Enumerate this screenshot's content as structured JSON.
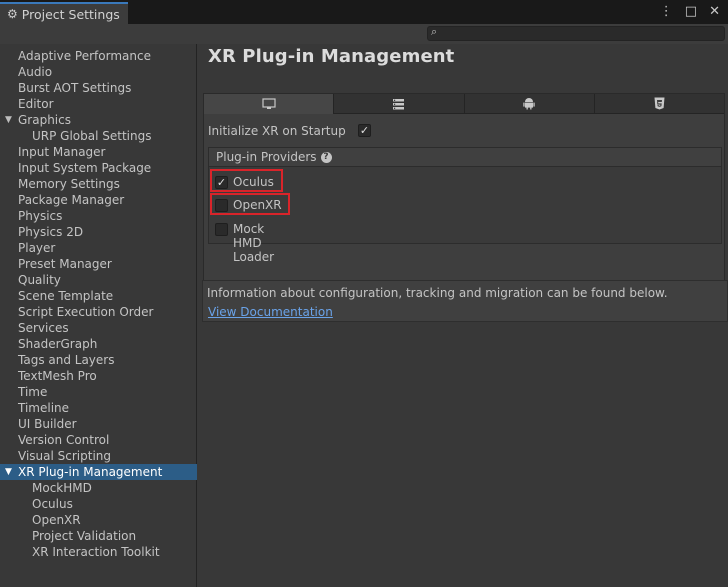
{
  "window": {
    "tab_title": "Project Settings",
    "menu_icon": "kebab-menu-icon",
    "maximize_icon": "maximize-icon",
    "close_icon": "close-icon"
  },
  "search": {
    "placeholder": "",
    "icon": "search-icon"
  },
  "sidebar": {
    "items": [
      {
        "label": "Adaptive Performance"
      },
      {
        "label": "Audio"
      },
      {
        "label": "Burst AOT Settings"
      },
      {
        "label": "Editor"
      },
      {
        "label": "Graphics"
      },
      {
        "label": "URP Global Settings"
      },
      {
        "label": "Input Manager"
      },
      {
        "label": "Input System Package"
      },
      {
        "label": "Memory Settings"
      },
      {
        "label": "Package Manager"
      },
      {
        "label": "Physics"
      },
      {
        "label": "Physics 2D"
      },
      {
        "label": "Player"
      },
      {
        "label": "Preset Manager"
      },
      {
        "label": "Quality"
      },
      {
        "label": "Scene Template"
      },
      {
        "label": "Script Execution Order"
      },
      {
        "label": "Services"
      },
      {
        "label": "ShaderGraph"
      },
      {
        "label": "Tags and Layers"
      },
      {
        "label": "TextMesh Pro"
      },
      {
        "label": "Time"
      },
      {
        "label": "Timeline"
      },
      {
        "label": "UI Builder"
      },
      {
        "label": "Version Control"
      },
      {
        "label": "Visual Scripting"
      },
      {
        "label": "XR Plug-in Management"
      },
      {
        "label": "MockHMD"
      },
      {
        "label": "Oculus"
      },
      {
        "label": "OpenXR"
      },
      {
        "label": "Project Validation"
      },
      {
        "label": "XR Interaction Toolkit"
      }
    ],
    "selected": "XR Plug-in Management"
  },
  "main": {
    "title": "XR Plug-in Management",
    "platform_tabs": [
      {
        "icon": "desktop-icon",
        "active": true
      },
      {
        "icon": "server-icon",
        "active": false
      },
      {
        "icon": "android-icon",
        "active": false
      },
      {
        "icon": "html5-icon",
        "active": false
      }
    ],
    "init_label": "Initialize XR on Startup",
    "init_checked": true,
    "providers_header": "Plug-in Providers",
    "providers": [
      {
        "label": "Oculus",
        "checked": true
      },
      {
        "label": "OpenXR",
        "checked": false
      },
      {
        "label": "Mock HMD Loader",
        "checked": false
      }
    ],
    "info_text": "Information about configuration, tracking and migration can be found below.",
    "doc_link": "View Documentation"
  },
  "colors": {
    "selection": "#2c5d87",
    "highlight_box": "#d9242a",
    "link": "#6aa3e9"
  }
}
